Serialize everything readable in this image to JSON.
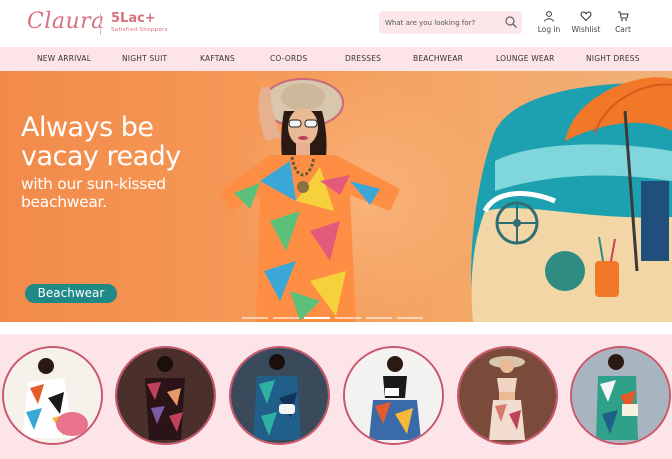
{
  "brand": {
    "logo_text": "Claura",
    "stat_number": "5Lac+",
    "stat_caption": "Satisfied Shoppers",
    "color": "#d9707f"
  },
  "search": {
    "placeholder": "What are you looking for?",
    "icon": "search-icon"
  },
  "header_actions": [
    {
      "label": "Log in",
      "icon": "user-icon"
    },
    {
      "label": "Wishlist",
      "icon": "heart-icon"
    },
    {
      "label": "Cart",
      "icon": "cart-icon"
    }
  ],
  "nav": {
    "items": [
      "NEW ARRIVAL",
      "NIGHT SUIT",
      "KAFTANS",
      "CO-ORDS",
      "DRESSES",
      "BEACHWEAR",
      "LOUNGE WEAR",
      "NIGHT DRESS"
    ]
  },
  "hero": {
    "headline_line1": "Always be",
    "headline_line2": "vacay ready",
    "subline_line1": "with our sun-kissed",
    "subline_line2": "beachwear.",
    "cta_label": "Beachwear",
    "cta_color": "#1f8a85",
    "background_color": "#f59a58",
    "slide_count": 6,
    "active_slide": 2
  },
  "category_circles": {
    "count": 6,
    "border_color": "#c9566b",
    "background_color": "#fce4e8"
  }
}
